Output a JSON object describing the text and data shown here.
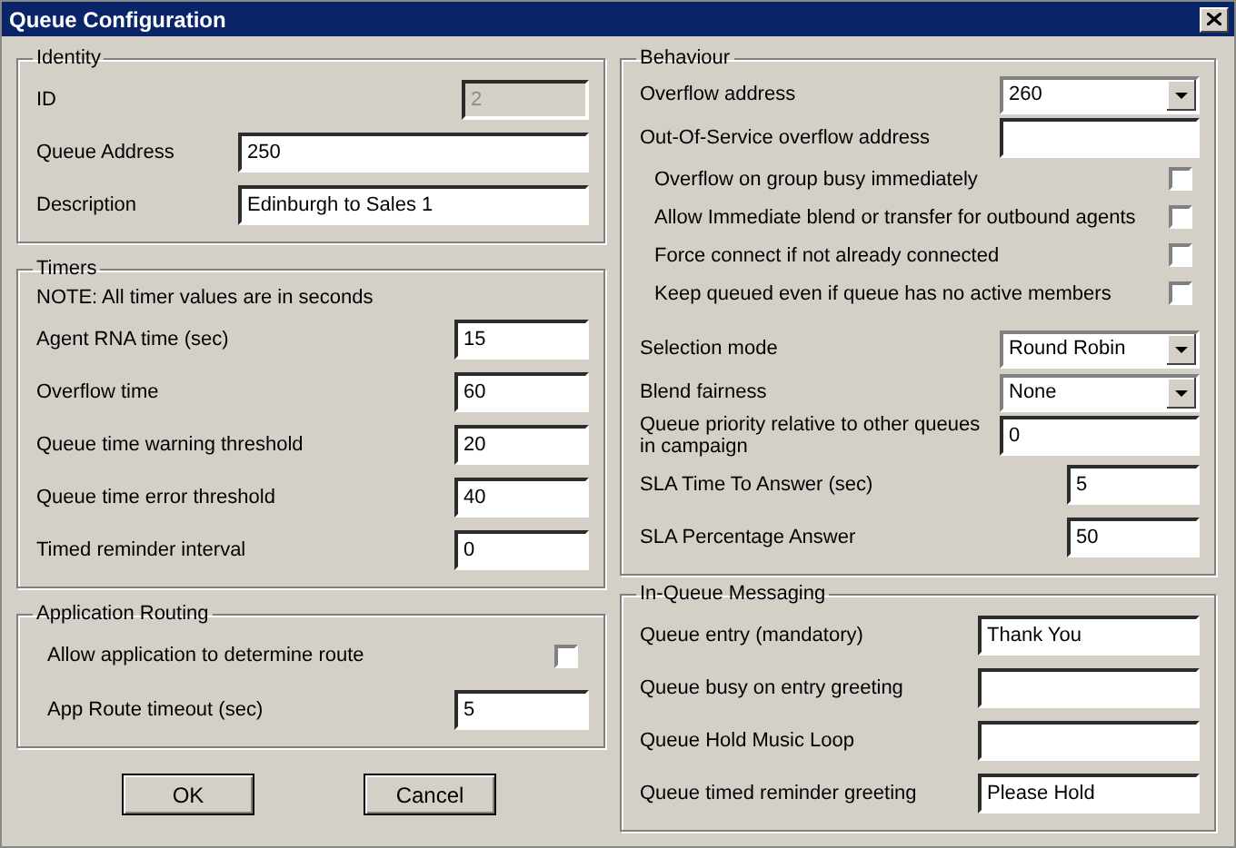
{
  "window": {
    "title": "Queue Configuration"
  },
  "left": [
    {
      "title": "Identity",
      "rows": [
        {
          "kind": "short_field",
          "label": "ID",
          "value": "2",
          "disabled": true
        },
        {
          "kind": "field",
          "label": "Queue Address",
          "value": "250",
          "disabled": false
        },
        {
          "kind": "field",
          "label": "Description",
          "value": "Edinburgh to Sales 1",
          "disabled": false
        }
      ]
    },
    {
      "title": "Timers",
      "rows": [
        {
          "kind": "note",
          "label": "NOTE: All timer values are in seconds"
        },
        {
          "kind": "field",
          "label": "Agent RNA time (sec)",
          "value": "15",
          "disabled": false
        },
        {
          "kind": "field",
          "label": "Overflow time",
          "value": "60",
          "disabled": false
        },
        {
          "kind": "field",
          "label": "Queue time warning threshold",
          "value": "20",
          "disabled": false
        },
        {
          "kind": "field",
          "label": "Queue time error threshold",
          "value": "40",
          "disabled": false
        },
        {
          "kind": "field",
          "label": "Timed reminder interval",
          "value": "0",
          "disabled": false
        }
      ]
    },
    {
      "title": "Application Routing",
      "rows": [
        {
          "kind": "check",
          "label": "Allow application to determine route",
          "checked": false
        },
        {
          "kind": "field",
          "label": "App Route timeout (sec)",
          "value": "5",
          "disabled": false
        }
      ]
    }
  ],
  "buttons": [
    "OK",
    "Cancel"
  ],
  "right": [
    {
      "title": "Behaviour",
      "rows": [
        {
          "kind": "dropdown",
          "label": "Overflow address",
          "value": "260"
        },
        {
          "kind": "field",
          "label": "Out-Of-Service overflow address",
          "disabled": false
        },
        {
          "kind": "check",
          "label": "Overflow on group busy immediately",
          "checked": false
        },
        {
          "kind": "check",
          "label": "Allow Immediate blend or transfer for outbound agents",
          "checked": false
        },
        {
          "kind": "check",
          "label": "Force connect if not already connected",
          "checked": false
        },
        {
          "kind": "check",
          "label": "Keep queued even if queue has no active members",
          "checked": false
        },
        {
          "kind": "dropdown",
          "label": "Selection mode",
          "value": "Round Robin"
        },
        {
          "kind": "dropdown",
          "label": "Blend fairness",
          "value": "None"
        },
        {
          "kind": "field",
          "label": "Queue priority relative to other queues in campaign",
          "value": "0",
          "disabled": false
        },
        {
          "kind": "short_field",
          "label": "SLA Time To Answer (sec)",
          "value": "5",
          "disabled": false
        },
        {
          "kind": "short_field",
          "label": "SLA Percentage Answer",
          "value": "50",
          "disabled": false
        }
      ]
    },
    {
      "title": "In-Queue Messaging",
      "rows": [
        {
          "kind": "field",
          "label": "Queue entry (mandatory)",
          "value": "Thank You",
          "disabled": false
        },
        {
          "kind": "field",
          "label": "Queue busy on entry greeting",
          "disabled": false
        },
        {
          "kind": "field",
          "label": "Queue Hold Music Loop",
          "disabled": false
        },
        {
          "kind": "field",
          "label": "Queue timed reminder greeting",
          "value": "Please Hold",
          "disabled": false
        }
      ]
    }
  ]
}
